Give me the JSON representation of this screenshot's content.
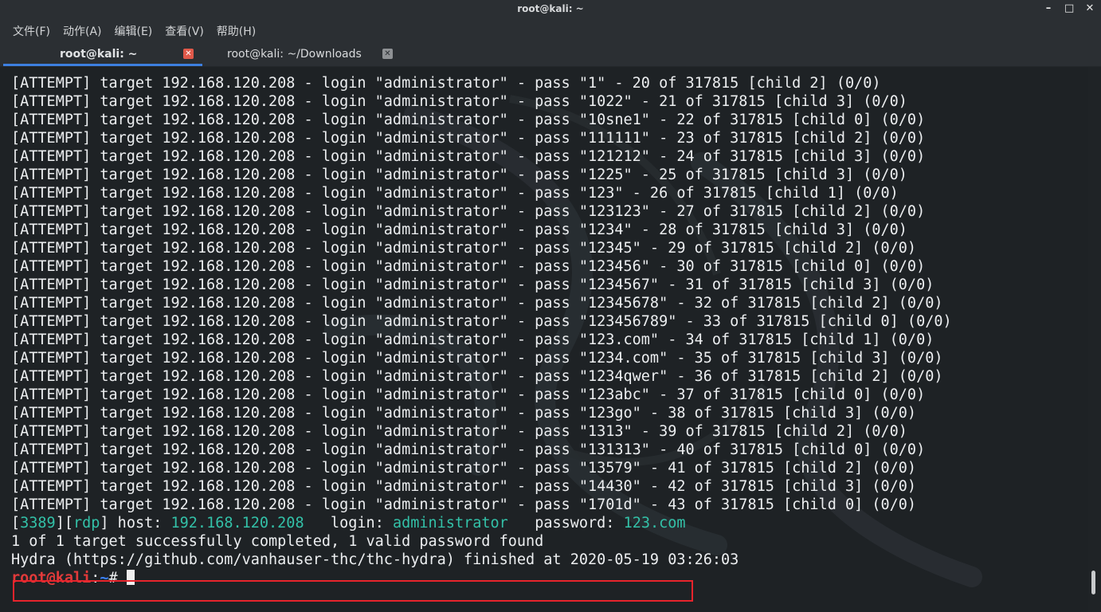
{
  "window": {
    "title": "root@kali: ~",
    "controls": {
      "minimize": "–",
      "maximize": "□",
      "close": "✕"
    }
  },
  "menu": [
    "文件(F)",
    "动作(A)",
    "编辑(E)",
    "查看(V)",
    "帮助(H)"
  ],
  "tabs": [
    {
      "label": "root@kali: ~",
      "active": true,
      "close_icon": "✕"
    },
    {
      "label": "root@kali: ~/Downloads",
      "active": false,
      "close_icon": "✕"
    }
  ],
  "terminal": {
    "attempt_prefix": "[ATTEMPT] target 192.168.120.208 - login \"administrator\" - pass ",
    "attempts": [
      "\"1\" - 20 of 317815 [child 2] (0/0)",
      "\"1022\" - 21 of 317815 [child 3] (0/0)",
      "\"10sne1\" - 22 of 317815 [child 0] (0/0)",
      "\"111111\" - 23 of 317815 [child 2] (0/0)",
      "\"121212\" - 24 of 317815 [child 3] (0/0)",
      "\"1225\" - 25 of 317815 [child 3] (0/0)",
      "\"123\" - 26 of 317815 [child 1] (0/0)",
      "\"123123\" - 27 of 317815 [child 2] (0/0)",
      "\"1234\" - 28 of 317815 [child 3] (0/0)",
      "\"12345\" - 29 of 317815 [child 2] (0/0)",
      "\"123456\" - 30 of 317815 [child 0] (0/0)",
      "\"1234567\" - 31 of 317815 [child 3] (0/0)",
      "\"12345678\" - 32 of 317815 [child 2] (0/0)",
      "\"123456789\" - 33 of 317815 [child 0] (0/0)",
      "\"123.com\" - 34 of 317815 [child 1] (0/0)",
      "\"1234.com\" - 35 of 317815 [child 3] (0/0)",
      "\"1234qwer\" - 36 of 317815 [child 2] (0/0)",
      "\"123abc\" - 37 of 317815 [child 0] (0/0)",
      "\"123go\" - 38 of 317815 [child 3] (0/0)",
      "\"1313\" - 39 of 317815 [child 2] (0/0)",
      "\"131313\" - 40 of 317815 [child 0] (0/0)",
      "\"13579\" - 41 of 317815 [child 2] (0/0)",
      "\"14430\" - 42 of 317815 [child 3] (0/0)",
      "\"1701d\" - 43 of 317815 [child 0] (0/0)"
    ],
    "found": {
      "port": "3389",
      "service": "rdp",
      "host_label": " host: ",
      "host": "192.168.120.208",
      "login_label": "   login: ",
      "login": "administrator",
      "password_label": "   password: ",
      "password": "123.com"
    },
    "summary": "1 of 1 target successfully completed, 1 valid password found",
    "finished": "Hydra (https://github.com/vanhauser-thc/thc-hydra) finished at 2020-05-19 03:26:03",
    "prompt_user": "root@kali",
    "prompt_sep": ":",
    "prompt_path": "~",
    "prompt_symbol": "# "
  },
  "colors": {
    "found_highlight": "#33c1a8",
    "prompt_user": "#e23a3a",
    "prompt_path": "#3b82ff",
    "annotation_box": "#e8242c",
    "active_tab_underline": "#3d7fe0"
  }
}
